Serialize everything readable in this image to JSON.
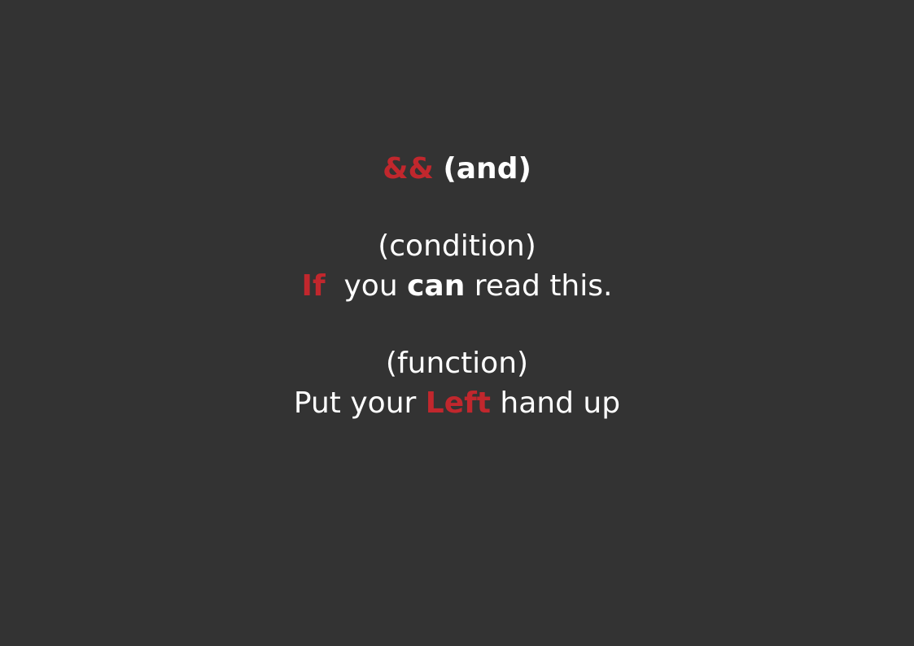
{
  "slide": {
    "heading": {
      "operator": "&&",
      "label": "(and)"
    },
    "condition": {
      "label": "(condition)",
      "keyword": "If",
      "text_before": "you ",
      "emphasis": "can",
      "text_after": " read this."
    },
    "function": {
      "label": "(function)",
      "text_before": "Put your ",
      "keyword": "Left",
      "text_after": " hand up"
    }
  },
  "colors": {
    "background": "#333333",
    "text": "#ffffff",
    "accent": "#c1272d"
  }
}
